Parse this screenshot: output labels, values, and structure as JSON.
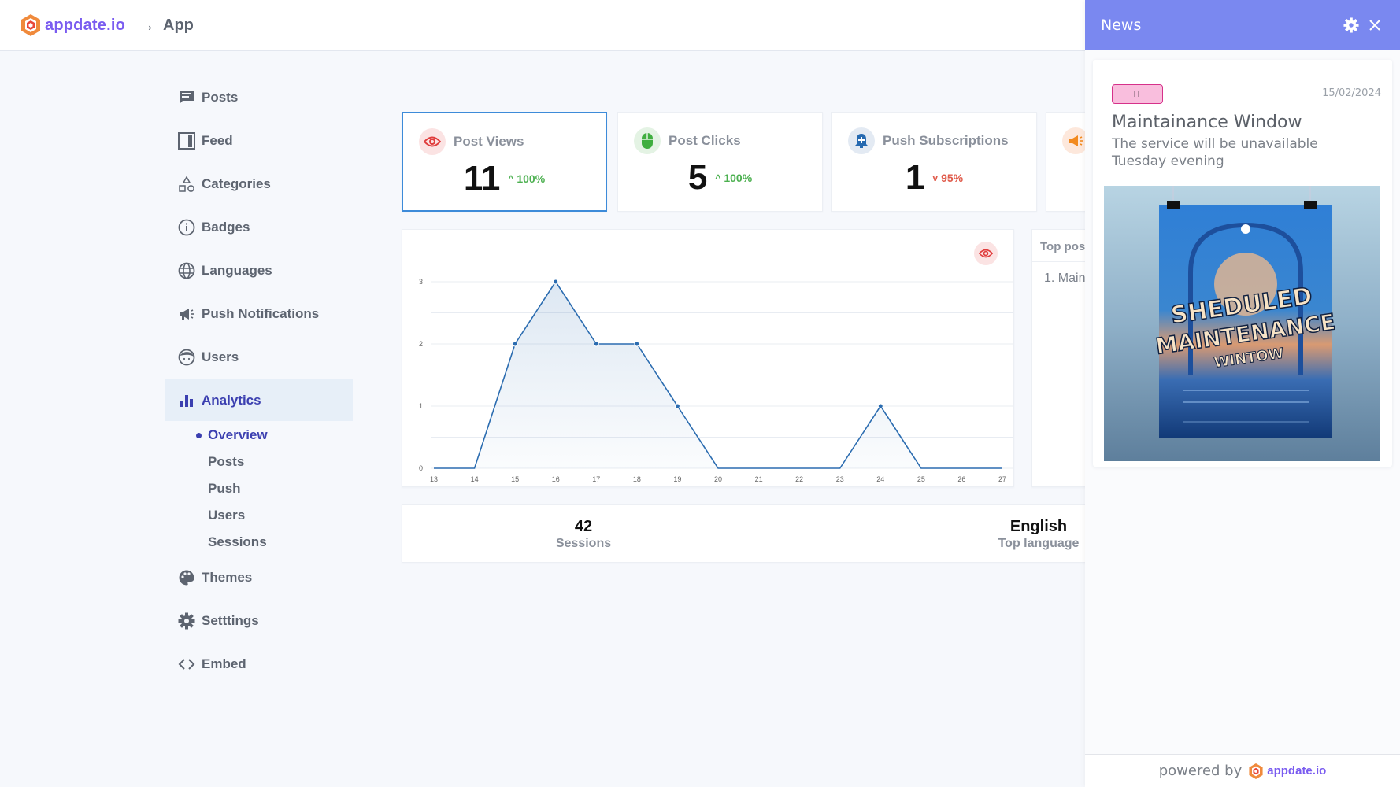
{
  "brand": {
    "name": "appdate.io",
    "color": "#7a5cf0"
  },
  "breadcrumb": {
    "separator": "→",
    "current": "App"
  },
  "sidebar": {
    "items": [
      {
        "label": "Posts",
        "icon": "posts-icon"
      },
      {
        "label": "Feed",
        "icon": "feed-icon"
      },
      {
        "label": "Categories",
        "icon": "categories-icon"
      },
      {
        "label": "Badges",
        "icon": "badge-info-icon"
      },
      {
        "label": "Languages",
        "icon": "globe-icon"
      },
      {
        "label": "Push Notifications",
        "icon": "megaphone-icon"
      },
      {
        "label": "Users",
        "icon": "user-face-icon"
      },
      {
        "label": "Analytics",
        "icon": "bar-chart-icon",
        "active": true
      },
      {
        "label": "Themes",
        "icon": "palette-icon"
      },
      {
        "label": "Setttings",
        "icon": "gear-icon"
      },
      {
        "label": "Embed",
        "icon": "code-icon"
      }
    ],
    "analytics_sub": [
      {
        "label": "Overview",
        "active": true
      },
      {
        "label": "Posts"
      },
      {
        "label": "Push"
      },
      {
        "label": "Users"
      },
      {
        "label": "Sessions"
      }
    ]
  },
  "stats": [
    {
      "label": "Post Views",
      "value": "11",
      "change": "100%",
      "direction": "up",
      "icon": "eye-icon",
      "icon_color": "#e03c3c",
      "icon_bg": "#fbe3e3",
      "selected": true
    },
    {
      "label": "Post Clicks",
      "value": "5",
      "change": "100%",
      "direction": "up",
      "icon": "mouse-icon",
      "icon_color": "#3fae3f",
      "icon_bg": "#e4f3e4"
    },
    {
      "label": "Push Subscriptions",
      "value": "1",
      "change": "95%",
      "direction": "down",
      "icon": "bell-plus-icon",
      "icon_color": "#2569b0",
      "icon_bg": "#e3eaf3"
    },
    {
      "label": "",
      "value": "",
      "icon": "megaphone-icon",
      "icon_color": "#f28a1f",
      "icon_bg": "#fde8dc"
    }
  ],
  "chart_data": {
    "type": "line",
    "title": "",
    "xlabel": "",
    "ylabel": "",
    "x": [
      13,
      14,
      15,
      16,
      17,
      18,
      19,
      20,
      21,
      22,
      23,
      24,
      25,
      26,
      27
    ],
    "series": [
      {
        "name": "Post Views",
        "values": [
          0,
          0,
          2,
          3,
          2,
          2,
          1,
          0,
          0,
          0,
          0,
          1,
          0,
          0,
          0
        ]
      }
    ],
    "ylim": [
      0,
      3
    ],
    "yticks": [
      0,
      1,
      2,
      3
    ],
    "grid": true,
    "fill": "area-gradient",
    "line_color": "#2b6cb0",
    "toggle_icon": "eye-icon"
  },
  "top_posts": {
    "title": "Top pos",
    "items": [
      "1. Main"
    ]
  },
  "summary": [
    {
      "value": "42",
      "label": "Sessions"
    },
    {
      "value": "English",
      "label": "Top language"
    }
  ],
  "news": {
    "title": "News",
    "header_color": "#7a88f0",
    "items": [
      {
        "tag": "IT",
        "date": "15/02/2024",
        "headline": "Maintainance Window",
        "body": "The service will be unavailable Tuesday evening",
        "image_alt": "Sheduled Maintenance Wintow poster",
        "image_text": [
          "SHEDULED",
          "MAINTENANCE",
          "WINTOW"
        ]
      }
    ],
    "footer": {
      "powered_by": "powered by",
      "brand": "appdate.io"
    }
  }
}
